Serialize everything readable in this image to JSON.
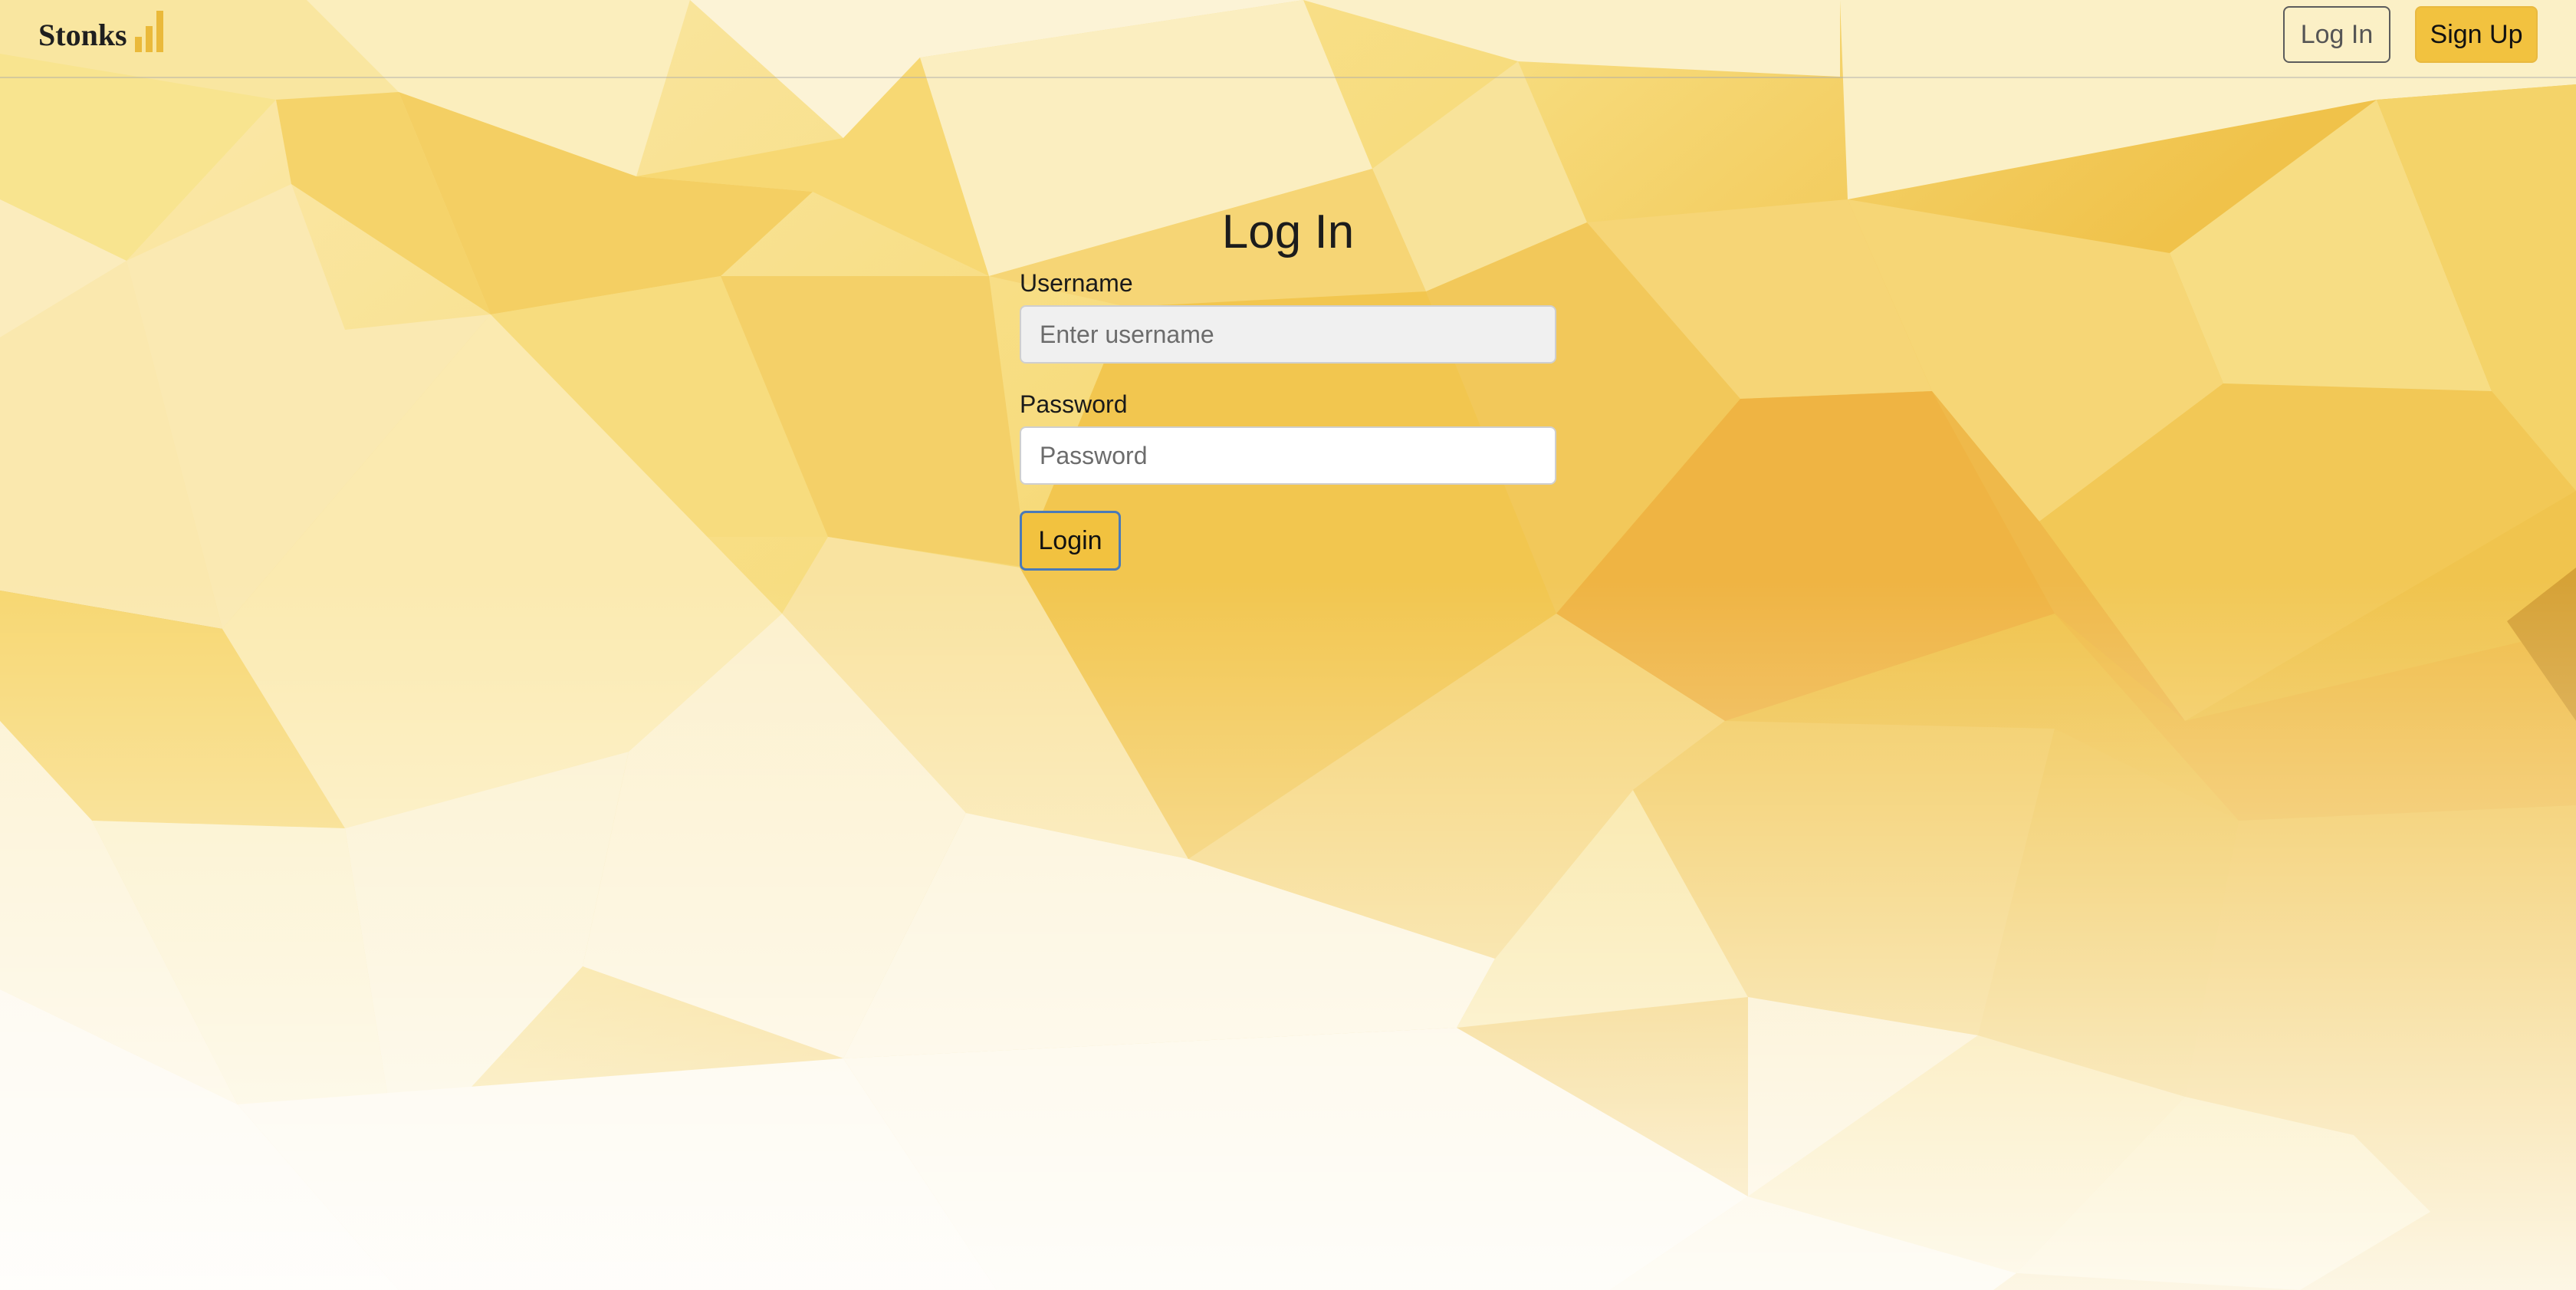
{
  "navbar": {
    "brand_name": "Stonks",
    "brand_icon": "bar-chart-icon",
    "login_label": "Log In",
    "signup_label": "Sign Up"
  },
  "login_form": {
    "title": "Log In",
    "username_label": "Username",
    "username_placeholder": "Enter username",
    "password_label": "Password",
    "password_placeholder": "Password",
    "submit_label": "Login"
  },
  "colors": {
    "accent": "#f2c23f",
    "background_pattern": "yellow-low-poly"
  }
}
